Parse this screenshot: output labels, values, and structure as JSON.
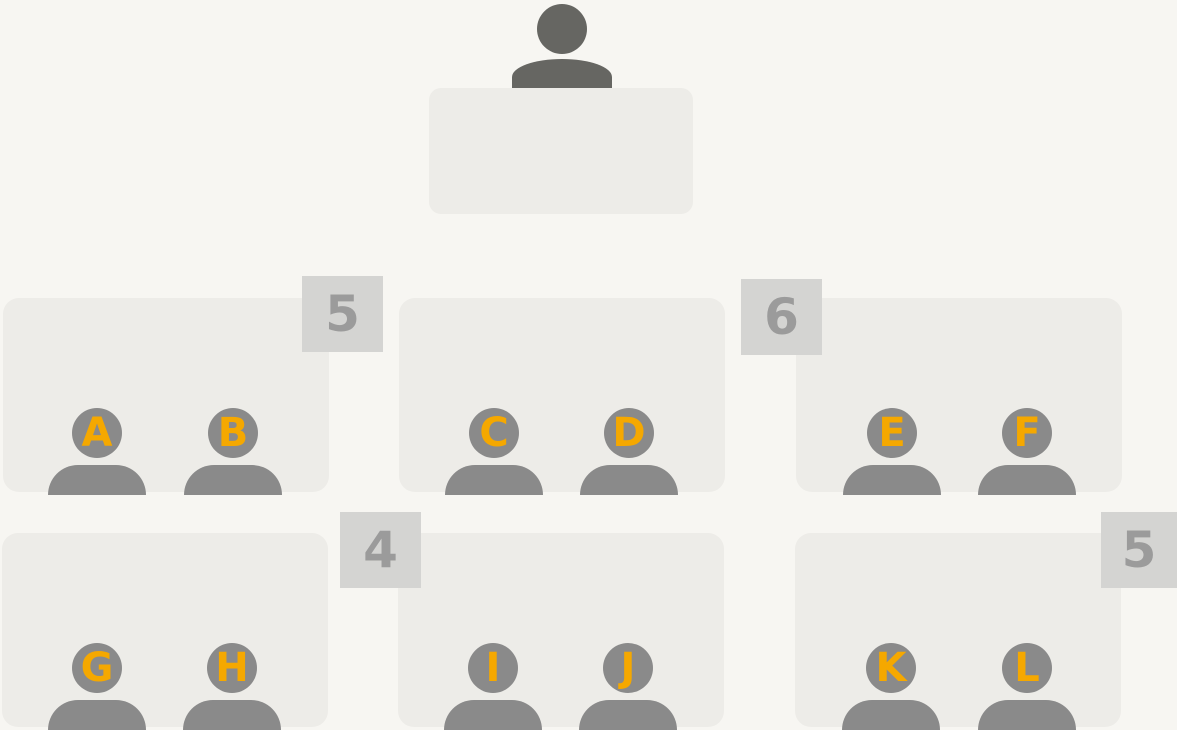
{
  "colors": {
    "background": "#f7f6f2",
    "desk": "#edece8",
    "badge_bg": "#d4d4d2",
    "badge_text": "#9b9b9b",
    "teacher": "#666662",
    "student": "#8a8a8a",
    "student_label": "#f5a800"
  },
  "icons": {
    "teacher": "person-icon",
    "student": "person-icon"
  },
  "desks": [
    {
      "students": [
        "A",
        "B"
      ],
      "badge": "5"
    },
    {
      "students": [
        "C",
        "D"
      ],
      "badge": ""
    },
    {
      "students": [
        "E",
        "F"
      ],
      "badge": "6"
    },
    {
      "students": [
        "G",
        "H"
      ],
      "badge": "4"
    },
    {
      "students": [
        "I",
        "J"
      ],
      "badge": ""
    },
    {
      "students": [
        "K",
        "L"
      ],
      "badge": "5"
    }
  ]
}
